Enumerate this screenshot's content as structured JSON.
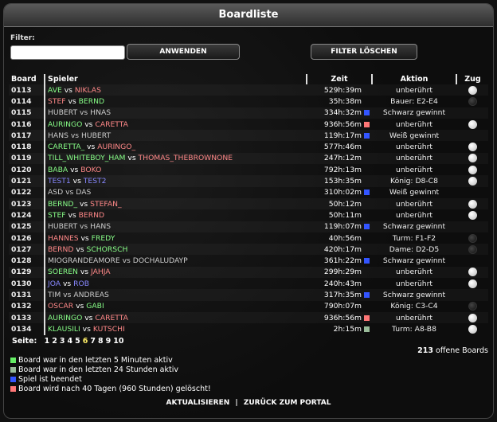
{
  "title": "Boardliste",
  "filter": {
    "label": "Filter:",
    "value": "",
    "apply": "ANWENDEN",
    "clear": "FILTER LÖSCHEN"
  },
  "headers": {
    "board": "Board",
    "spieler": "Spieler",
    "zeit": "Zeit",
    "aktion": "Aktion",
    "zug": "Zug"
  },
  "vs": "vs",
  "colors": {
    "green": "#88ff88",
    "red": "#ff8888",
    "blue": "#8888ff",
    "gray": "#cccccc",
    "yellow": "#ffee66",
    "active5": "#66ee66",
    "active24": "#99bb99",
    "ended": "#3355ff",
    "deleted": "#ff7777"
  },
  "rows": [
    {
      "board": "0113",
      "p1": "AVE",
      "c1": "g",
      "p2": "NIKLAS",
      "c2": "r",
      "time": "529h:39m",
      "sq": "",
      "action": "unberührt",
      "zug": "white"
    },
    {
      "board": "0114",
      "p1": "STEF",
      "c1": "r",
      "p2": "BERND",
      "c2": "g",
      "time": "35h:38m",
      "sq": "",
      "action": "Bauer: E2-E4",
      "zug": "dark"
    },
    {
      "board": "0115",
      "p1": "HUBERT",
      "c1": "gr",
      "p2": "HNAS",
      "c2": "gr",
      "time": "334h:32m",
      "sq": "ended",
      "action": "Schwarz gewinnt",
      "zug": ""
    },
    {
      "board": "0116",
      "p1": "AURINGO",
      "c1": "g",
      "p2": "CARETTA",
      "c2": "r",
      "time": "936h:56m",
      "sq": "deleted",
      "action": "unberührt",
      "zug": "white"
    },
    {
      "board": "0117",
      "p1": "HANS",
      "c1": "gr",
      "p2": "HUBERT",
      "c2": "gr",
      "time": "119h:17m",
      "sq": "ended",
      "action": "Weiß gewinnt",
      "zug": ""
    },
    {
      "board": "0118",
      "p1": "CARETTA_",
      "c1": "g",
      "p2": "AURINGO_",
      "c2": "r",
      "time": "577h:46m",
      "sq": "",
      "action": "unberührt",
      "zug": "white"
    },
    {
      "board": "0119",
      "p1": "TILL_WHITEBOY_HAM",
      "c1": "g",
      "p2": "THOMAS_THEBROWNONE",
      "c2": "r",
      "time": "247h:12m",
      "sq": "",
      "action": "unberührt",
      "zug": "white"
    },
    {
      "board": "0120",
      "p1": "BABA",
      "c1": "g",
      "p2": "BOKO",
      "c2": "r",
      "time": "792h:13m",
      "sq": "",
      "action": "unberührt",
      "zug": "white"
    },
    {
      "board": "0121",
      "p1": "TEST1",
      "c1": "b",
      "p2": "TEST2",
      "c2": "b",
      "time": "153h:35m",
      "sq": "",
      "action": "König: D8-C8",
      "zug": "white"
    },
    {
      "board": "0122",
      "p1": "ASD",
      "c1": "gr",
      "p2": "DAS",
      "c2": "gr",
      "time": "310h:02m",
      "sq": "ended",
      "action": "Weiß gewinnt",
      "zug": ""
    },
    {
      "board": "0123",
      "p1": "BERND_",
      "c1": "g",
      "p2": "STEFAN_",
      "c2": "r",
      "time": "50h:12m",
      "sq": "",
      "action": "unberührt",
      "zug": "white"
    },
    {
      "board": "0124",
      "p1": "STEF",
      "c1": "g",
      "p2": "BERND",
      "c2": "r",
      "time": "50h:11m",
      "sq": "",
      "action": "unberührt",
      "zug": "white"
    },
    {
      "board": "0125",
      "p1": "HUBERT",
      "c1": "gr",
      "p2": "HANS",
      "c2": "gr",
      "time": "119h:07m",
      "sq": "ended",
      "action": "Schwarz gewinnt",
      "zug": ""
    },
    {
      "board": "0126",
      "p1": "HANNES",
      "c1": "r",
      "p2": "FREDY",
      "c2": "g",
      "time": "40h:56m",
      "sq": "",
      "action": "Turm: F1-F2",
      "zug": "dark"
    },
    {
      "board": "0127",
      "p1": "BERND",
      "c1": "r",
      "p2": "SCHORSCH",
      "c2": "g",
      "time": "420h:17m",
      "sq": "",
      "action": "Dame: D2-D5",
      "zug": "dark"
    },
    {
      "board": "0128",
      "p1": "MIOGRANDEAMORE",
      "c1": "gr",
      "p2": "DOCHALUDAYP",
      "c2": "gr",
      "time": "361h:22m",
      "sq": "ended",
      "action": "Schwarz gewinnt",
      "zug": ""
    },
    {
      "board": "0129",
      "p1": "SOEREN",
      "c1": "g",
      "p2": "JAHJA",
      "c2": "r",
      "time": "299h:29m",
      "sq": "",
      "action": "unberührt",
      "zug": "white"
    },
    {
      "board": "0130",
      "p1": "JOA",
      "c1": "b",
      "p2": "ROB",
      "c2": "b",
      "time": "240h:43m",
      "sq": "",
      "action": "unberührt",
      "zug": "white"
    },
    {
      "board": "0131",
      "p1": "TIM",
      "c1": "gr",
      "p2": "ANDREAS",
      "c2": "gr",
      "time": "317h:35m",
      "sq": "ended",
      "action": "Schwarz gewinnt",
      "zug": ""
    },
    {
      "board": "0132",
      "p1": "OSCAR",
      "c1": "r",
      "p2": "GABI",
      "c2": "g",
      "time": "790h:07m",
      "sq": "",
      "action": "König: C3-C4",
      "zug": "dark"
    },
    {
      "board": "0133",
      "p1": "AURINGO",
      "c1": "g",
      "p2": "CARETTA",
      "c2": "r",
      "time": "936h:56m",
      "sq": "deleted",
      "action": "unberührt",
      "zug": "white"
    },
    {
      "board": "0134",
      "p1": "KLAUSILI",
      "c1": "g",
      "p2": "KUTSCHI",
      "c2": "r",
      "time": "2h:15m",
      "sq": "active24",
      "action": "Turm: A8-B8",
      "zug": "white"
    }
  ],
  "pager": {
    "label": "Seite:",
    "pages": [
      "1",
      "2",
      "3",
      "4",
      "5",
      "6",
      "7",
      "8",
      "9",
      "10"
    ],
    "current": "6"
  },
  "open_boards": {
    "count": "213",
    "label": "offene Boards"
  },
  "legend": [
    {
      "color": "active5",
      "text": "Board war in den letzten 5 Minuten aktiv"
    },
    {
      "color": "active24",
      "text": "Board war in den letzten 24 Stunden aktiv"
    },
    {
      "color": "ended",
      "text": "Spiel ist beendet"
    },
    {
      "color": "deleted",
      "text": "Board wird nach 40 Tagen (960 Stunden) gelöscht!"
    }
  ],
  "footer": {
    "refresh": "AKTUALISIEREN",
    "sep": "|",
    "back": "ZURÜCK ZUM PORTAL"
  }
}
